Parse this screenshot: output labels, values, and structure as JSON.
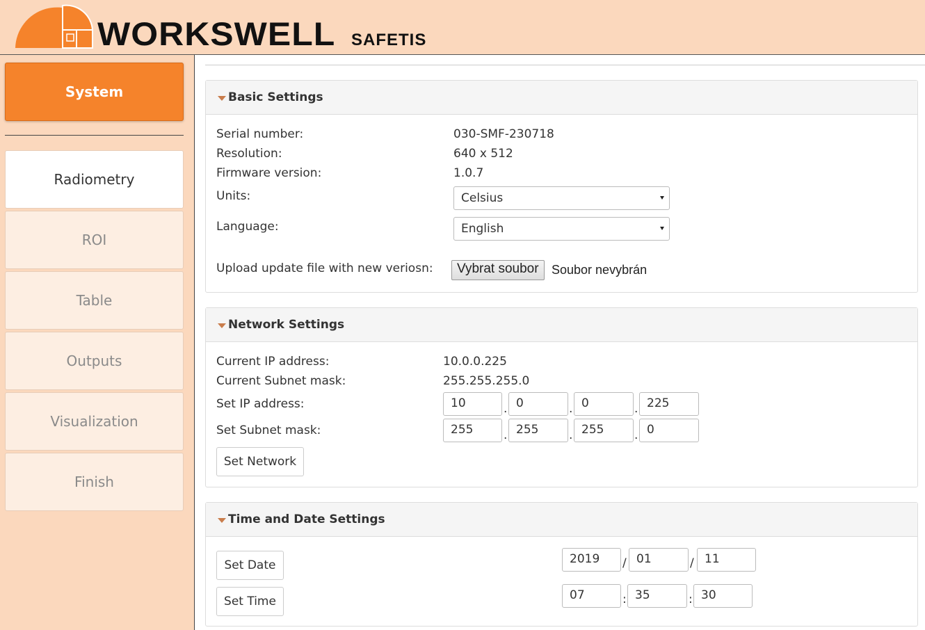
{
  "brand": {
    "name": "WORKSWELL",
    "product": "SAFETIS"
  },
  "sidebar": {
    "items": [
      {
        "label": "System"
      },
      {
        "label": "Radiometry"
      },
      {
        "label": "ROI"
      },
      {
        "label": "Table"
      },
      {
        "label": "Outputs"
      },
      {
        "label": "Visualization"
      },
      {
        "label": "Finish"
      }
    ]
  },
  "basic": {
    "title": "Basic Settings",
    "serial_label": "Serial number:",
    "serial_value": "030-SMF-230718",
    "resolution_label": "Resolution:",
    "resolution_value": "640 x 512",
    "firmware_label": "Firmware version:",
    "firmware_value": "1.0.7",
    "units_label": "Units:",
    "units_value": "Celsius",
    "language_label": "Language:",
    "language_value": "English",
    "upload_label": "Upload update file with new veriosn:",
    "file_button": "Vybrat soubor",
    "file_status": "Soubor nevybrán"
  },
  "network": {
    "title": "Network Settings",
    "current_ip_label": "Current IP address:",
    "current_ip_value": "10.0.0.225",
    "current_mask_label": "Current Subnet mask:",
    "current_mask_value": "255.255.255.0",
    "set_ip_label": "Set IP address:",
    "set_ip": [
      "10",
      "0",
      "0",
      "225"
    ],
    "set_mask_label": "Set Subnet mask:",
    "set_mask": [
      "255",
      "255",
      "255",
      "0"
    ],
    "separator": ".",
    "button": "Set Network"
  },
  "datetime": {
    "title": "Time and Date Settings",
    "date_button": "Set Date",
    "time_button": "Set Time",
    "date": [
      "2019",
      "01",
      "11"
    ],
    "date_separator": "/",
    "time": [
      "07",
      "35",
      "30"
    ],
    "time_separator": ":"
  },
  "colors": {
    "accent": "#f5832b",
    "header_bg": "#fbd8bd",
    "caret": "#c97d4c"
  }
}
